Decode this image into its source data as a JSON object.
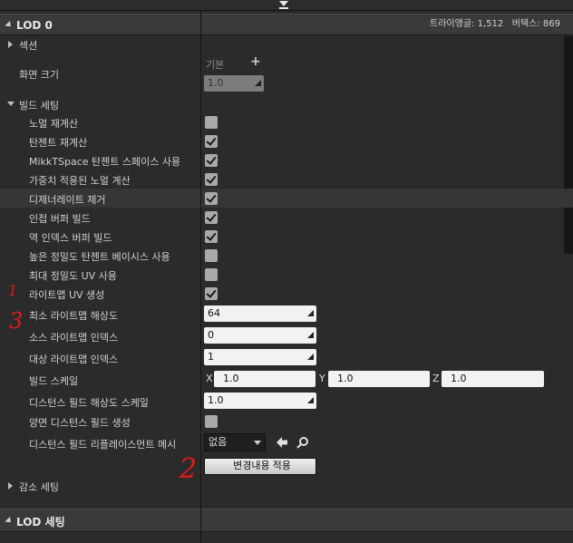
{
  "header": {
    "lod_title": "LOD 0",
    "triangles": "트라이앵글: 1,512",
    "vertices": "버텍스: 869"
  },
  "section": {
    "label": "섹션"
  },
  "screen_size": {
    "label": "화면 크기",
    "default_label": "기본",
    "value": "1.0"
  },
  "build_settings": {
    "label": "빌드 세팅",
    "recompute_normals": {
      "label": "노멀 재계산",
      "checked": false
    },
    "recompute_tangents": {
      "label": "탄젠트 재계산",
      "checked": true
    },
    "use_mikktspace": {
      "label": "MikkTSpace 탄젠트 스페이스 사용",
      "checked": true
    },
    "weighted_normals": {
      "label": "가중치 적용된 노멀 계산",
      "checked": true
    },
    "remove_degenerates": {
      "label": "디제너레이트 제거",
      "checked": true
    },
    "adjacency_buffer": {
      "label": "인접 버퍼 빌드",
      "checked": true
    },
    "reversed_index_buffer": {
      "label": "역 인덱스 버퍼 빌드",
      "checked": true
    },
    "high_precision_tangent": {
      "label": "높은 정밀도 탄젠트 베이시스 사용",
      "checked": false
    },
    "full_precision_uvs": {
      "label": "최대 정밀도 UV 사용",
      "checked": false
    },
    "generate_lightmap_uvs": {
      "label": "라이트맵 UV 생성",
      "checked": true
    },
    "min_lightmap_resolution": {
      "label": "최소 라이트맵 해상도",
      "value": "64"
    },
    "source_lightmap_index": {
      "label": "소스 라이트맵 인덱스",
      "value": "0"
    },
    "dest_lightmap_index": {
      "label": "대상 라이트맵 인덱스",
      "value": "1"
    },
    "build_scale": {
      "label": "빌드 스케일",
      "x_label": "X",
      "x": "1.0",
      "y_label": "Y",
      "y": "1.0",
      "z_label": "Z",
      "z": "1.0"
    },
    "distance_field_resolution_scale": {
      "label": "디스턴스 필드 해상도 스케일",
      "value": "1.0"
    },
    "two_sided_distance_field": {
      "label": "양면 디스턴스 필드 생성",
      "checked": false
    },
    "distance_field_replacement_mesh": {
      "label": "디스턴스 필드 리플레이스먼트 메시",
      "value": "없음"
    },
    "apply_changes_button": "변경내용 적용"
  },
  "reduction_settings": {
    "label": "감소 세팅"
  },
  "lod_settings": {
    "title": "LOD 세팅"
  },
  "annotations": {
    "one": "1",
    "two": "2",
    "three": "3"
  },
  "colors": {
    "background": "#2b2b2b",
    "category": "#3a3a3a",
    "annotation": "#e41919"
  }
}
